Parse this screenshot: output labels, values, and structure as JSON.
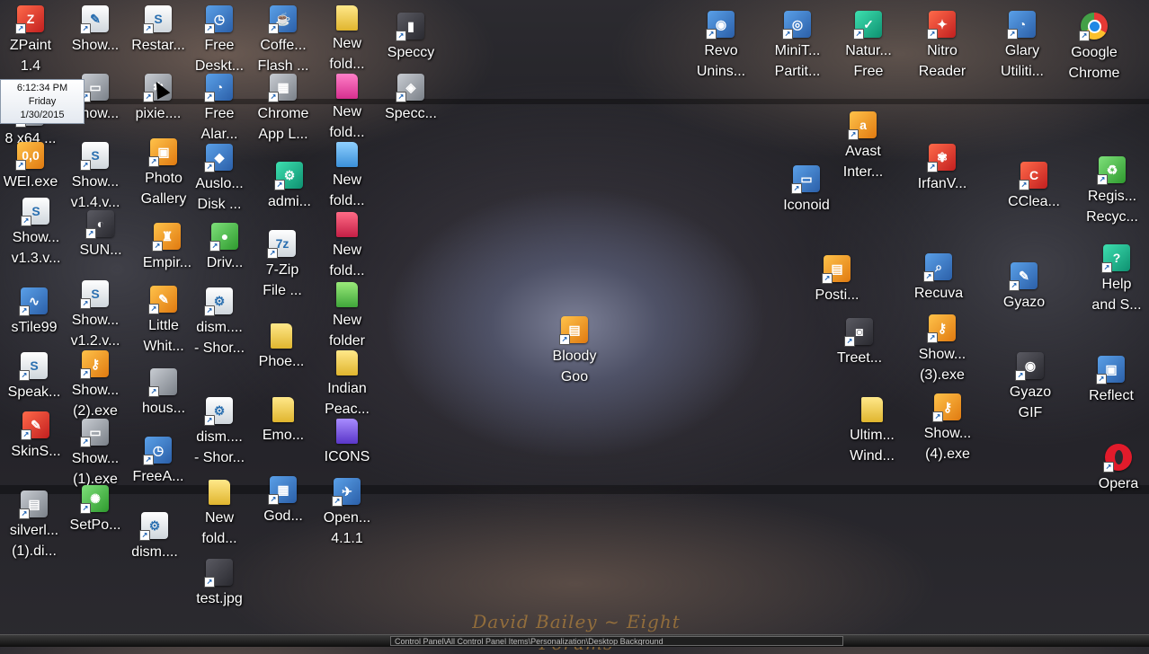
{
  "clock": {
    "time": "6:12:34 PM",
    "day": "Friday",
    "date": "1/30/2015"
  },
  "icons": [
    {
      "label": "ZPaint\n1.4",
      "name": "zpaint-icon",
      "style": "red",
      "glyph": "Z"
    },
    {
      "label": "Show...",
      "name": "show-icon",
      "style": "doc",
      "glyph": "✎"
    },
    {
      "label": "Restar...",
      "name": "restart-script-icon",
      "style": "doc",
      "glyph": "S"
    },
    {
      "label": "Free\nDeskt...",
      "name": "free-desktop-clock-icon",
      "style": "app",
      "glyph": "◷"
    },
    {
      "label": "Coffe...\nFlash ...",
      "name": "coffee-flash-icon",
      "style": "app",
      "glyph": "☕"
    },
    {
      "label": "New\nfold...",
      "name": "new-folder-icon",
      "style": "folder",
      "glyph": ""
    },
    {
      "label": "Speccy",
      "name": "speccy-icon",
      "style": "dark",
      "glyph": "▮"
    },
    {
      "label": "8 x64 ...",
      "name": "x64-shortcut-icon",
      "style": "gray",
      "glyph": ""
    },
    {
      "label": "Show...",
      "name": "show-window-icon",
      "style": "gray",
      "glyph": "▭"
    },
    {
      "label": "pixie....",
      "name": "pixie-icon",
      "style": "gray",
      "glyph": "✱"
    },
    {
      "label": "Free\nAlar...",
      "name": "free-alarm-icon",
      "style": "app",
      "glyph": "◔"
    },
    {
      "label": "Chrome\nApp L...",
      "name": "chrome-app-launcher-icon",
      "style": "gray",
      "glyph": "▦"
    },
    {
      "label": "New\nfold...",
      "name": "new-folder-pink-icon",
      "style": "folder-pink",
      "glyph": ""
    },
    {
      "label": "Specc...",
      "name": "speccy-shortcut-icon",
      "style": "gray",
      "glyph": "◈"
    },
    {
      "label": "WEI.exe",
      "name": "wei-exe-icon",
      "style": "orange",
      "glyph": "0,0"
    },
    {
      "label": "Show...\nv1.4.v...",
      "name": "show-v14-icon",
      "style": "doc",
      "glyph": "S"
    },
    {
      "label": "Photo\nGallery",
      "name": "photo-gallery-icon",
      "style": "orange",
      "glyph": "▣"
    },
    {
      "label": "Auslo...\nDisk ...",
      "name": "auslogics-disk-icon",
      "style": "app",
      "glyph": "◆"
    },
    {
      "label": "admi...",
      "name": "admin-tools-icon",
      "style": "teal",
      "glyph": "⚙"
    },
    {
      "label": "New\nfold...",
      "name": "new-folder-blue-icon",
      "style": "folder-blue",
      "glyph": ""
    },
    {
      "label": "Show...\nv1.3.v...",
      "name": "show-v13-icon",
      "style": "doc",
      "glyph": "S"
    },
    {
      "label": "SUN...",
      "name": "sun-icon",
      "style": "dark",
      "glyph": "◐"
    },
    {
      "label": "Empir...",
      "name": "empire-icon",
      "style": "orange",
      "glyph": "♜"
    },
    {
      "label": "Driv...",
      "name": "driver-icon",
      "style": "green",
      "glyph": "●"
    },
    {
      "label": "7-Zip\nFile ...",
      "name": "7zip-icon",
      "style": "doc",
      "glyph": "7z"
    },
    {
      "label": "New\nfold...",
      "name": "new-folder-red-icon",
      "style": "folder-red",
      "glyph": ""
    },
    {
      "label": "sTile99",
      "name": "stile99-icon",
      "style": "app",
      "glyph": "∿"
    },
    {
      "label": "Show...\nv1.2.v...",
      "name": "show-v12-icon",
      "style": "doc",
      "glyph": "S"
    },
    {
      "label": "Little\nWhit...",
      "name": "little-white-icon",
      "style": "orange",
      "glyph": "✎"
    },
    {
      "label": "dism....\n- Shor...",
      "name": "dism-shortcut-icon",
      "style": "doc",
      "glyph": "⚙"
    },
    {
      "label": "New\nfolder",
      "name": "new-folder-green-icon",
      "style": "folder-green",
      "glyph": ""
    },
    {
      "label": "Phoe...",
      "name": "phoenix-folder-icon",
      "style": "folder",
      "glyph": ""
    },
    {
      "label": "Bloody\nGoo",
      "name": "bloody-goo-icon",
      "style": "orange",
      "glyph": "▤"
    },
    {
      "label": "Speak...",
      "name": "speak-icon",
      "style": "doc",
      "glyph": "S"
    },
    {
      "label": "Show...\n(2).exe",
      "name": "show-2-exe-icon",
      "style": "orange",
      "glyph": "⚷"
    },
    {
      "label": "hous...",
      "name": "house-icon",
      "style": "gray",
      "glyph": ""
    },
    {
      "label": "Indian\nPeac...",
      "name": "indian-peace-folder-icon",
      "style": "folder",
      "glyph": ""
    },
    {
      "label": "SkinS...",
      "name": "skinstudio-icon",
      "style": "red",
      "glyph": "✎"
    },
    {
      "label": "Show...\n(1).exe",
      "name": "show-1-exe-icon",
      "style": "gray",
      "glyph": "▭"
    },
    {
      "label": "FreeA...",
      "name": "free-alarm-clock-icon",
      "style": "app",
      "glyph": "◷"
    },
    {
      "label": "dism....\n- Shor...",
      "name": "dism-shortcut-2-icon",
      "style": "doc",
      "glyph": "⚙"
    },
    {
      "label": "Emo...",
      "name": "emo-folder-icon",
      "style": "folder",
      "glyph": ""
    },
    {
      "label": "ICONS",
      "name": "icons-folder-icon",
      "style": "folder-purple",
      "glyph": ""
    },
    {
      "label": "silverl...\n(1).di...",
      "name": "silverlight-icon",
      "style": "gray",
      "glyph": "▤"
    },
    {
      "label": "SetPo...",
      "name": "setpoint-icon",
      "style": "green",
      "glyph": "✺"
    },
    {
      "label": "dism....",
      "name": "dism-icon",
      "style": "doc",
      "glyph": "⚙"
    },
    {
      "label": "New\nfold...",
      "name": "new-folder-2-icon",
      "style": "folder",
      "glyph": ""
    },
    {
      "label": "God...",
      "name": "godmode-icon",
      "style": "app",
      "glyph": "▦"
    },
    {
      "label": "Open...\n4.1.1",
      "name": "openoffice-icon",
      "style": "app",
      "glyph": "✈"
    },
    {
      "label": "test.jpg",
      "name": "test-jpg-icon",
      "style": "dark",
      "glyph": ""
    },
    {
      "label": "Revo\nUnins...",
      "name": "revo-uninstaller-icon",
      "style": "app",
      "glyph": "◉"
    },
    {
      "label": "MiniT...\nPartit...",
      "name": "minitool-partition-icon",
      "style": "app",
      "glyph": "◎"
    },
    {
      "label": "Natur...\nFree",
      "name": "natural-free-icon",
      "style": "teal",
      "glyph": "✓"
    },
    {
      "label": "Nitro\nReader",
      "name": "nitro-reader-icon",
      "style": "red",
      "glyph": "✦"
    },
    {
      "label": "Glary\nUtiliti...",
      "name": "glary-utilities-icon",
      "style": "app",
      "glyph": "◔"
    },
    {
      "label": "Google\nChrome",
      "name": "google-chrome-icon",
      "style": "chrome",
      "glyph": ""
    },
    {
      "label": "Avast\nInter...",
      "name": "avast-icon",
      "style": "orange",
      "glyph": "a"
    },
    {
      "label": "Iconoid",
      "name": "iconoid-icon",
      "style": "app",
      "glyph": "▭"
    },
    {
      "label": "IrfanV...",
      "name": "irfanview-icon",
      "style": "red",
      "glyph": "✾"
    },
    {
      "label": "CClea...",
      "name": "ccleaner-icon",
      "style": "red",
      "glyph": "C"
    },
    {
      "label": "Regis...\nRecyc...",
      "name": "registry-recycler-icon",
      "style": "green",
      "glyph": "♻"
    },
    {
      "label": "Posti...",
      "name": "postit-icon",
      "style": "orange",
      "glyph": "▤"
    },
    {
      "label": "Recuva",
      "name": "recuva-icon",
      "style": "app",
      "glyph": "⌕"
    },
    {
      "label": "Gyazo",
      "name": "gyazo-icon",
      "style": "app",
      "glyph": "✎"
    },
    {
      "label": "Help\nand S...",
      "name": "help-support-icon",
      "style": "teal",
      "glyph": "?"
    },
    {
      "label": "Treet...",
      "name": "treetop-icon",
      "style": "dark",
      "glyph": "◙"
    },
    {
      "label": "Show...\n(3).exe",
      "name": "show-3-exe-icon",
      "style": "orange",
      "glyph": "⚷"
    },
    {
      "label": "Gyazo\nGIF",
      "name": "gyazo-gif-icon",
      "style": "dark",
      "glyph": "◉"
    },
    {
      "label": "Reflect",
      "name": "reflect-icon",
      "style": "app",
      "glyph": "▣"
    },
    {
      "label": "Ultim...\nWind...",
      "name": "ultimate-windows-folder-icon",
      "style": "folder",
      "glyph": ""
    },
    {
      "label": "Show...\n(4).exe",
      "name": "show-4-exe-icon",
      "style": "orange",
      "glyph": "⚷"
    },
    {
      "label": "Opera",
      "name": "opera-icon",
      "style": "opera",
      "glyph": ""
    }
  ],
  "watermark": "David Bailey ~ Eight Forums",
  "taskbar": {
    "address": "Control Panel\\All Control Panel Items\\Personalization\\Desktop Background"
  }
}
